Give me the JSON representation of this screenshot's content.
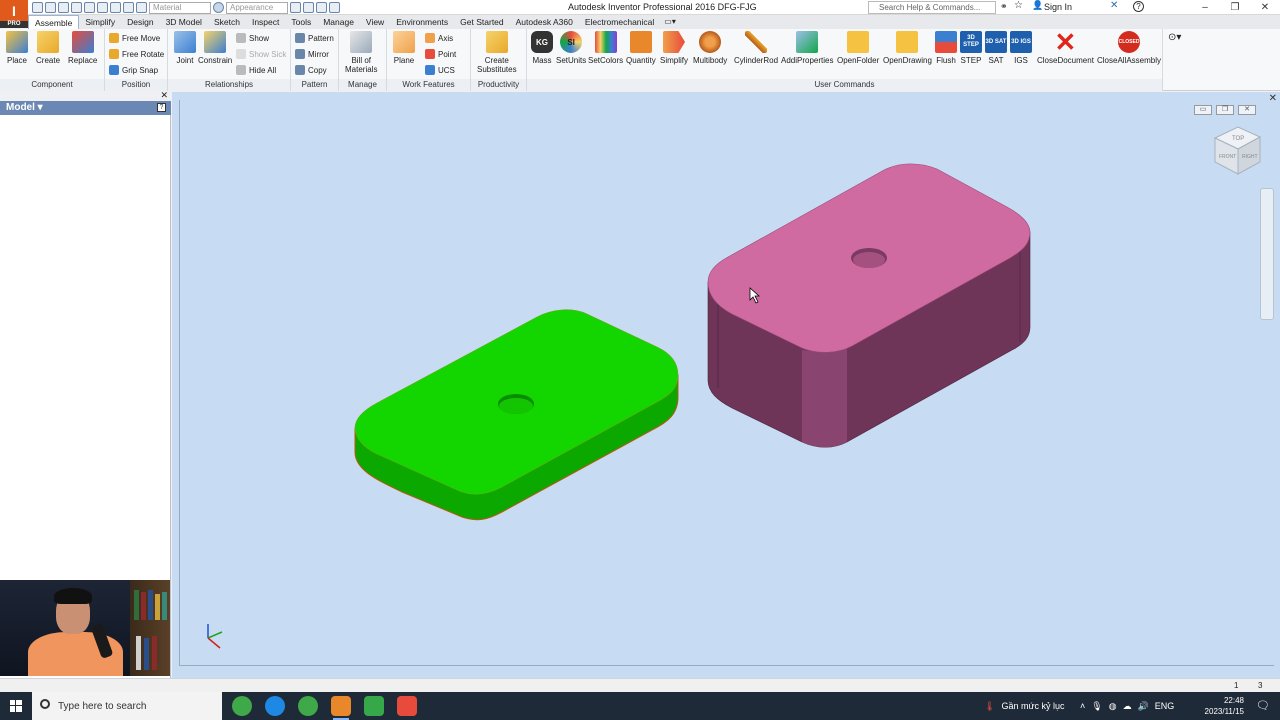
{
  "window": {
    "title": "Autodesk Inventor Professional 2016   DFG-FJG",
    "search_placeholder": "Search Help & Commands...",
    "sign_in": "Sign In"
  },
  "quick_access": {
    "material": "Material",
    "appearance": "Appearance"
  },
  "tabs": [
    "Assemble",
    "Simplify",
    "Design",
    "3D Model",
    "Sketch",
    "Inspect",
    "Tools",
    "Manage",
    "View",
    "Environments",
    "Get Started",
    "Autodesk A360",
    "Electromechanical"
  ],
  "ribbon": {
    "component": {
      "label": "Component",
      "place": "Place",
      "create": "Create",
      "replace": "Replace"
    },
    "position": {
      "label": "Position",
      "free_move": "Free Move",
      "free_rotate": "Free Rotate",
      "grip_snap": "Grip Snap"
    },
    "relationships": {
      "label": "Relationships",
      "joint": "Joint",
      "constrain": "Constrain",
      "show": "Show",
      "show_sick": "Show Sick",
      "hide_all": "Hide All"
    },
    "pattern": {
      "label": "Pattern",
      "pattern": "Pattern",
      "mirror": "Mirror",
      "copy": "Copy"
    },
    "manage": {
      "label": "Manage",
      "bom_line1": "Bill of",
      "bom_line2": "Materials"
    },
    "work_features": {
      "label": "Work Features",
      "plane": "Plane",
      "axis": "Axis",
      "point": "Point",
      "ucs": "UCS"
    },
    "productivity": {
      "label": "Productivity",
      "line1": "Create",
      "line2": "Substitutes"
    },
    "user_commands": {
      "label": "User Commands",
      "items": [
        "Mass",
        "SetUnits",
        "SetColors",
        "Quantity",
        "Simplify",
        "Multibody",
        "CylinderRod",
        "AddiProperties",
        "OpenFolder",
        "OpenDrawing",
        "Flush",
        "STEP",
        "SAT",
        "IGS",
        "CloseDocument",
        "CloseAllAssembly"
      ],
      "icon_texts": {
        "step": "3D STEP",
        "sat": "3D SAT",
        "igs": "3D IGS",
        "closed": "CLOSED",
        "kg": "KG",
        "si": "SI"
      }
    }
  },
  "browser": {
    "title": "Model"
  },
  "viewcube": {
    "top": "TOP",
    "front": "FRONT",
    "right": "RIGHT"
  },
  "status": {
    "left": "1",
    "right": "3"
  },
  "taskbar": {
    "search_placeholder": "Type here to search",
    "weather": "Gần mức kỷ lục",
    "lang": "ENG",
    "time": "22:48",
    "date": "2023/11/15"
  },
  "colors": {
    "viewport_bg": "#c7dcf2",
    "green_part": "#13d600",
    "pink_part": "#d06ba1",
    "ribbon_accent": "#6b88b4"
  }
}
